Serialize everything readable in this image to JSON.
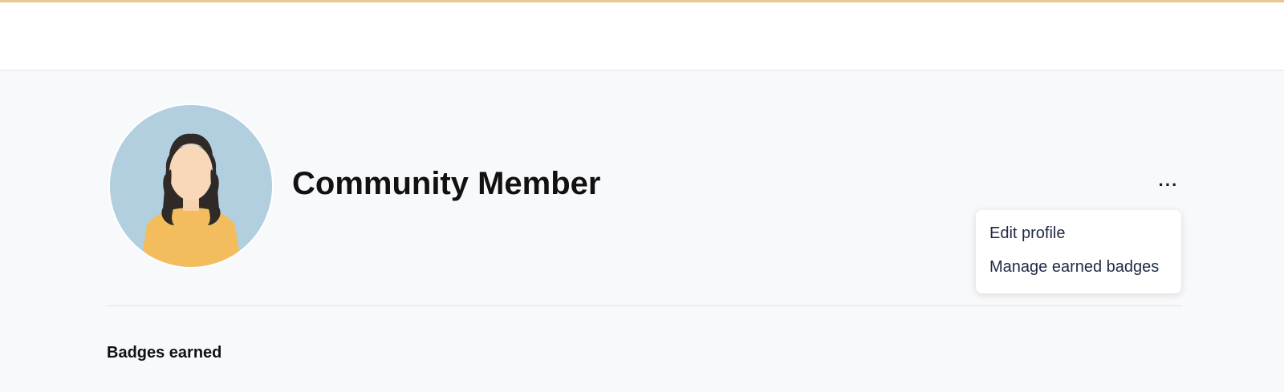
{
  "profile": {
    "name": "Community Member",
    "avatar_icon": "user-avatar-illustration",
    "more_icon": "more-horizontal-icon",
    "more_label": "···"
  },
  "menu": {
    "items": [
      {
        "label": "Edit profile"
      },
      {
        "label": "Manage earned badges"
      }
    ]
  },
  "badges": {
    "heading": "Badges earned"
  },
  "colors": {
    "page_background": "#f8f9fb",
    "header_background": "#ffffff",
    "top_accent": "#e7c890",
    "avatar_background": "#b2cfe0",
    "menu_text": "#1f2a44"
  }
}
